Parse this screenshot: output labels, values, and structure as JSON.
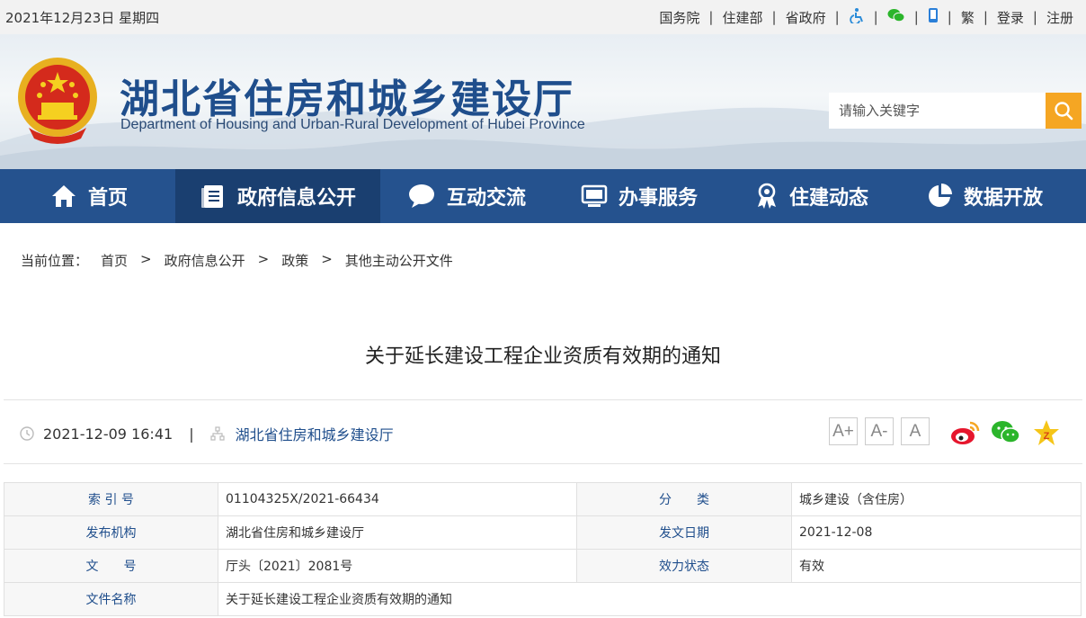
{
  "topbar": {
    "date": "2021年12月23日 星期四",
    "links": [
      "国务院",
      "住建部",
      "省政府"
    ],
    "lang": "繁",
    "login": "登录",
    "register": "注册"
  },
  "header": {
    "title": "湖北省住房和城乡建设厅",
    "subtitle": "Department of Housing and Urban-Rural Development of Hubei Province",
    "search_placeholder": "请输入关键字"
  },
  "nav": [
    {
      "label": "首页",
      "icon": "home-icon"
    },
    {
      "label": "政府信息公开",
      "icon": "document-list-icon",
      "active": true
    },
    {
      "label": "互动交流",
      "icon": "chat-bubble-icon"
    },
    {
      "label": "办事服务",
      "icon": "monitor-icon"
    },
    {
      "label": "住建动态",
      "icon": "award-icon"
    },
    {
      "label": "数据开放",
      "icon": "pie-chart-icon"
    }
  ],
  "breadcrumb": {
    "prefix": "当前位置：",
    "items": [
      "首页",
      "政府信息公开",
      "政策",
      "其他主动公开文件"
    ],
    "separator": ">"
  },
  "article": {
    "title": "关于延长建设工程企业资质有效期的通知",
    "datetime": "2021-12-09 16:41",
    "divider": "|",
    "source": "湖北省住房和城乡建设厅"
  },
  "font_buttons": [
    "A+",
    "A-",
    "A"
  ],
  "share": [
    "weibo-icon",
    "wechat-icon",
    "favorite-star-icon"
  ],
  "info_table": [
    [
      {
        "k": "索 引 号",
        "v": "01104325X/2021-66434"
      },
      {
        "k": "分　　类",
        "v": "城乡建设（含住房）"
      }
    ],
    [
      {
        "k": "发布机构",
        "v": "湖北省住房和城乡建设厅"
      },
      {
        "k": "发文日期",
        "v": "2021-12-08"
      }
    ],
    [
      {
        "k": "文　　号",
        "v": "厅头〔2021〕2081号"
      },
      {
        "k": "效力状态",
        "v": "有效"
      }
    ],
    [
      {
        "k": "文件名称",
        "v": "关于延长建设工程企业资质有效期的通知"
      }
    ]
  ],
  "colors": {
    "nav": "#25528e",
    "nav_active": "#1a3f70",
    "accent": "#f5a623",
    "title": "#1f4e8c"
  }
}
